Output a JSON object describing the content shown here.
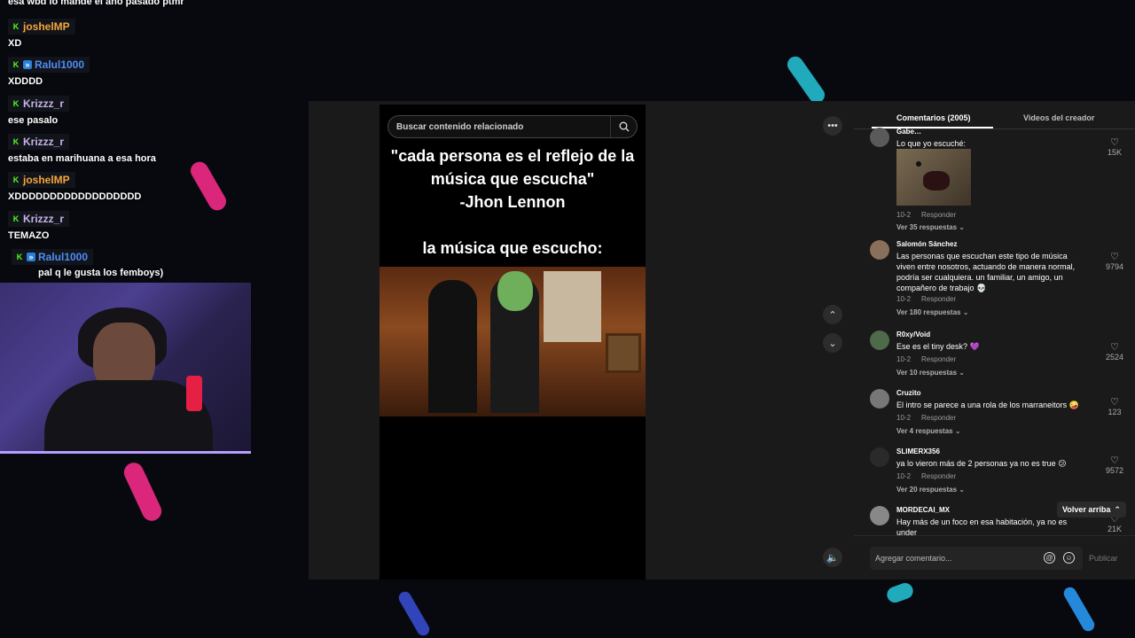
{
  "chat": {
    "top_partial": "esa wbd lo mande el año pasado ptmr",
    "messages": [
      {
        "user": "joshelMP",
        "color": "#f4a638",
        "text": "XD",
        "sub": false
      },
      {
        "user": "Ralul1000",
        "color": "#4d8df5",
        "text": "XDDDD",
        "sub": true
      },
      {
        "user": "Krizzz_r",
        "color": "#c5b3e6",
        "text": "ese pasalo",
        "sub": false
      },
      {
        "user": "Krizzz_r",
        "color": "#c5b3e6",
        "text": "estaba en marihuana a esa hora",
        "sub": false
      },
      {
        "user": "joshelMP",
        "color": "#f4a638",
        "text": "XDDDDDDDDDDDDDDDDDD",
        "sub": false
      },
      {
        "user": "Krizzz_r",
        "color": "#c5b3e6",
        "text": "TEMAZO",
        "sub": false
      },
      {
        "user": "Ralul1000",
        "color": "#4d8df5",
        "text": "pal q le gusta los femboys)",
        "sub": true
      }
    ]
  },
  "video": {
    "search_placeholder": "Buscar contenido relacionado",
    "quote_lines": [
      "\"cada persona es el reflejo de la",
      "música que escucha\"",
      "-Jhon Lennon",
      "",
      "la música que  escucho:"
    ]
  },
  "comments": {
    "tab_comments": "Comentarios (2005)",
    "tab_creator": "Videos del creador",
    "reply_label": "Responder",
    "items": [
      {
        "user": "Gabe…",
        "text": "Lo que yo escuché:",
        "date": "10-2",
        "likes": "15K",
        "replies": "Ver 35 respuestas",
        "has_image": true
      },
      {
        "user": "Salomón Sánchez",
        "text": "Las personas que escuchan este tipo de música viven entre nosotros, actuando de manera normal, podría ser cualquiera. un familiar, un amigo, un compañero de trabajo 💀",
        "date": "10-2",
        "likes": "9794",
        "replies": "Ver 180 respuestas"
      },
      {
        "user": "R0xy/Void",
        "text": "Ese es el tiny desk? 💜",
        "date": "10-2",
        "likes": "2524",
        "replies": "Ver 10 respuestas"
      },
      {
        "user": "Cruzito",
        "text": "El intro se parece a una rola de los marraneitors 🤪",
        "date": "10-2",
        "likes": "123",
        "replies": "Ver 4 respuestas"
      },
      {
        "user": "SLIMERX356",
        "text": "ya lo vieron más de 2 personas ya no es true 😕",
        "date": "10-2",
        "likes": "9572",
        "replies": "Ver 20 respuestas"
      },
      {
        "user": "MORDECAI_MX",
        "text": "Hay más de un foco en esa habitación, ya no es under",
        "date": "",
        "likes": "21K",
        "replies": ""
      }
    ],
    "back_to_top": "Volver arriba",
    "add_comment_placeholder": "Agregar comentario...",
    "publish": "Publicar"
  },
  "colors": {
    "accent": "#fe2c55",
    "kick_green": "#53fc18"
  }
}
